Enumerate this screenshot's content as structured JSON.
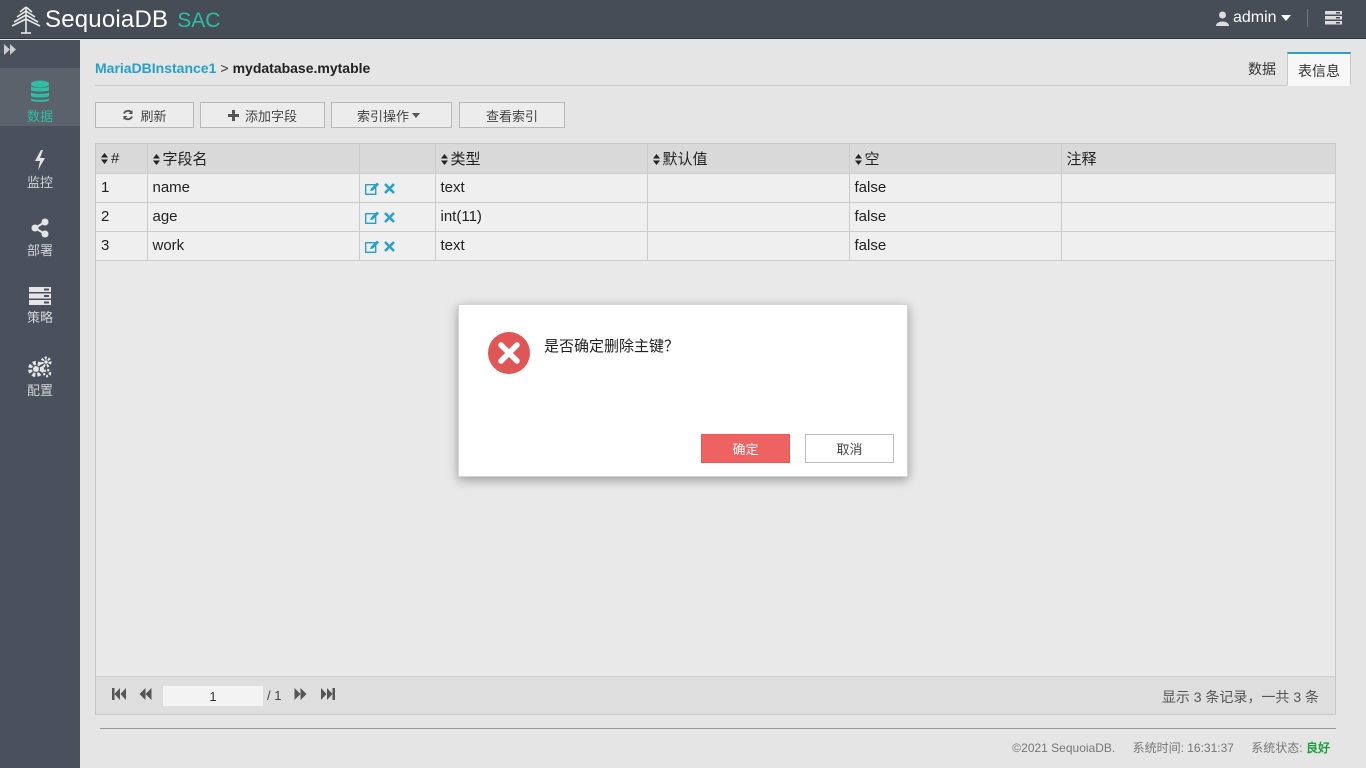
{
  "app": {
    "name": "SequoiaDB",
    "suffix": "SAC"
  },
  "header": {
    "user": "admin"
  },
  "sidebar": {
    "items": [
      {
        "label": "数据",
        "icon": "database-icon",
        "active": true
      },
      {
        "label": "监控",
        "icon": "bolt-icon"
      },
      {
        "label": "部署",
        "icon": "share-icon"
      },
      {
        "label": "策略",
        "icon": "server-icon"
      },
      {
        "label": "配置",
        "icon": "cogs-icon"
      }
    ]
  },
  "breadcrumb": {
    "instance": "MariaDBInstance1",
    "separator": ">",
    "current": "mydatabase.mytable"
  },
  "tabs": [
    {
      "label": "数据"
    },
    {
      "label": "表信息",
      "active": true
    }
  ],
  "toolbar": {
    "refresh": "刷新",
    "add_field": "添加字段",
    "index_ops": "索引操作",
    "view_index": "查看索引"
  },
  "table": {
    "columns": [
      "#",
      "字段名",
      "",
      "类型",
      "默认值",
      "空",
      "注释"
    ],
    "rows": [
      {
        "num": "1",
        "name": "name",
        "type": "text",
        "default": "",
        "nullable": "false",
        "comment": ""
      },
      {
        "num": "2",
        "name": "age",
        "type": "int(11)",
        "default": "",
        "nullable": "false",
        "comment": ""
      },
      {
        "num": "3",
        "name": "work",
        "type": "text",
        "default": "",
        "nullable": "false",
        "comment": ""
      }
    ]
  },
  "pager": {
    "page": "1",
    "total": "/ 1",
    "summary": "显示 3 条记录，一共 3 条"
  },
  "footer": {
    "copyright": "©2021 SequoiaDB.",
    "time_label": "系统时间: 16:31:37",
    "status_label": "系统状态:",
    "status_value": "良好"
  },
  "modal": {
    "message": "是否确定删除主键？",
    "ok": "确定",
    "cancel": "取消"
  },
  "colors": {
    "accent": "#27a1c9",
    "brand": "#2dbfa3",
    "danger": "#ef6262",
    "status_good": "#1e9e3e"
  }
}
